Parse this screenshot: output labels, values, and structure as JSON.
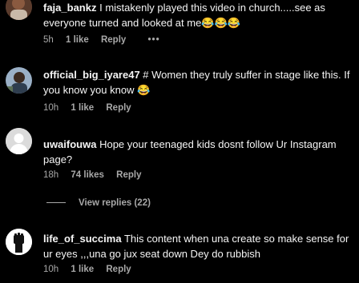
{
  "comments": [
    {
      "username": "faja_bankz",
      "text": "I mistakenly played this video in church.....see as everyone turned and looked at me",
      "emojis": "😂😂😂",
      "time": "5h",
      "likes": "1 like",
      "reply_label": "Reply",
      "more_label": "•••",
      "avatar_icon": "person-photo-avatar"
    },
    {
      "username": "official_big_iyare47",
      "text": "# Women they truly suffer in stage like this. If you know you know 😂",
      "time": "10h",
      "likes": "1 like",
      "reply_label": "Reply",
      "avatar_icon": "person-photo-avatar"
    },
    {
      "username": "uwaifouwa",
      "text": "Hope your teenaged kids dosnt follow Ur Instagram page?",
      "time": "18h",
      "likes": "74 likes",
      "reply_label": "Reply",
      "avatar_icon": "default-person-avatar"
    },
    {
      "username": "life_of_succima",
      "text": "This content when una create so make sense for ur eyes ,,,una go jux seat down Dey do rubbish",
      "time": "10h",
      "likes": "1 like",
      "reply_label": "Reply",
      "avatar_icon": "raised-fist-avatar"
    }
  ],
  "view_replies": "View replies (22)",
  "colors": {
    "background": "#000000",
    "primary_text": "#f5f5f5",
    "secondary_text": "#a8a8a8"
  }
}
